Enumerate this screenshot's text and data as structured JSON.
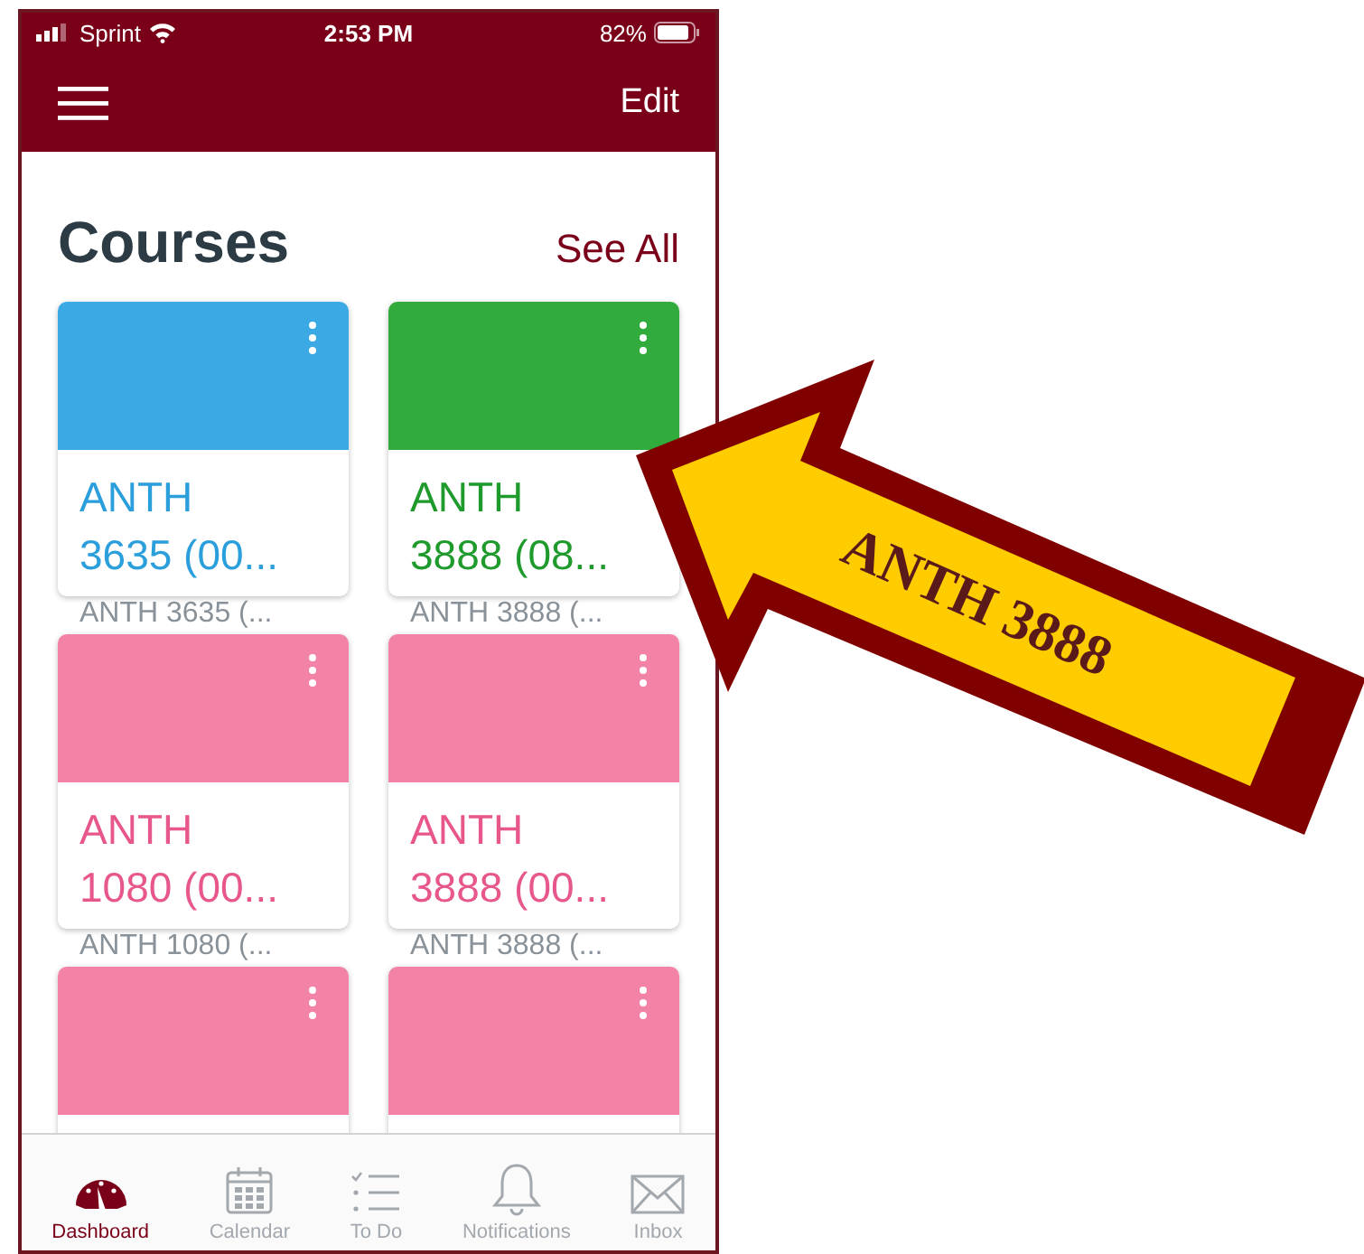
{
  "status_bar": {
    "carrier": "Sprint",
    "time": "2:53 PM",
    "battery": "82%"
  },
  "nav_bar": {
    "action": "Edit"
  },
  "section": {
    "title": "Courses",
    "link": "See All"
  },
  "courses": [
    {
      "color": "#3aa9e4",
      "title_lines": [
        "ANTH",
        "3635 (00..."
      ],
      "subtitle": "ANTH 3635 (..."
    },
    {
      "color": "#31ab3b",
      "title_lines": [
        "ANTH",
        "3888 (08..."
      ],
      "subtitle": "ANTH 3888 (..."
    },
    {
      "color": "#f282a6",
      "title_lines": [
        "ANTH",
        "1080 (00..."
      ],
      "subtitle": "ANTH 1080 (..."
    },
    {
      "color": "#f282a6",
      "title_lines": [
        "ANTH",
        "3888 (00..."
      ],
      "subtitle": "ANTH 3888 (..."
    },
    {
      "color": "#f282a6"
    },
    {
      "color": "#f282a6"
    }
  ],
  "tab_bar": [
    {
      "kind": "dashboard",
      "label": "Dashboard",
      "selected": true
    },
    {
      "kind": "calendar",
      "label": "Calendar",
      "selected": false
    },
    {
      "kind": "todo",
      "label": "To Do",
      "selected": false
    },
    {
      "kind": "notifications",
      "label": "Notifications",
      "selected": false
    },
    {
      "kind": "inbox",
      "label": "Inbox",
      "selected": false
    }
  ],
  "callout": {
    "label": "ANTH 3888"
  }
}
